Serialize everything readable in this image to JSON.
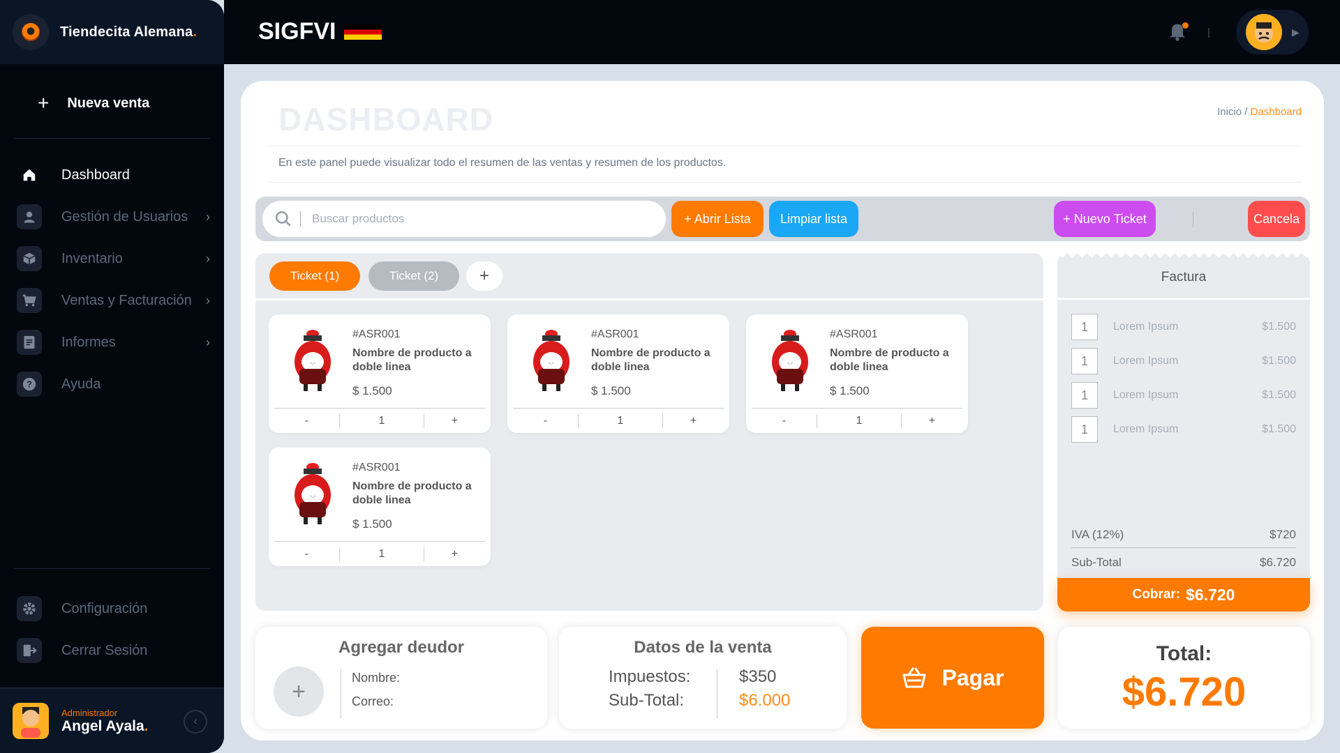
{
  "sidebar": {
    "brand": "Tiendecita Alemana",
    "brand_dot": ".",
    "new_sale": "Nueva venta",
    "items": [
      {
        "label": "Dashboard",
        "icon": "home-icon"
      },
      {
        "label": "Gestión de Usuarios",
        "icon": "user-icon"
      },
      {
        "label": "Inventario",
        "icon": "box-icon"
      },
      {
        "label": "Ventas y Facturación",
        "icon": "cart-icon"
      },
      {
        "label": "Informes",
        "icon": "report-icon"
      },
      {
        "label": "Ayuda",
        "icon": "help-icon"
      }
    ],
    "bottom_items": [
      {
        "label": "Configuración",
        "icon": "gear-icon"
      },
      {
        "label": "Cerrar Sesión",
        "icon": "logout-icon"
      }
    ],
    "profile": {
      "role": "Administrador",
      "name": "Angel Ayala",
      "name_dot": "."
    }
  },
  "topbar": {
    "title": "SIGFVI"
  },
  "main": {
    "title": "DASHBOARD",
    "breadcrumb": {
      "home": "Inicio",
      "sep": " / ",
      "current": "Dashboard"
    },
    "description": "En este panel puede visualizar todo el resumen de las ventas y resumen de los productos."
  },
  "toolbar": {
    "search_placeholder": "Buscar productos",
    "open_list": "+ Abrir Lista",
    "clear_list": "Limpiar lista",
    "new_ticket": "+ Nuevo Ticket",
    "cancel": "Cancela"
  },
  "tickets": {
    "tabs": [
      "Ticket (1)",
      "Ticket (2)"
    ],
    "add": "+",
    "products": [
      {
        "code": "#ASR001",
        "name": "Nombre de producto a doble linea",
        "price": "$ 1.500",
        "qty": "1"
      },
      {
        "code": "#ASR001",
        "name": "Nombre de producto a doble linea",
        "price": "$ 1.500",
        "qty": "1"
      },
      {
        "code": "#ASR001",
        "name": "Nombre de producto a doble linea",
        "price": "$ 1.500",
        "qty": "1"
      },
      {
        "code": "#ASR001",
        "name": "Nombre de producto a doble linea",
        "price": "$ 1.500",
        "qty": "1"
      }
    ],
    "minus": "-",
    "plus": "+"
  },
  "factura": {
    "title": "Factura",
    "rows": [
      {
        "qty": "1",
        "name": "Lorem Ipsum",
        "amount": "$1.500"
      },
      {
        "qty": "1",
        "name": "Lorem Ipsum",
        "amount": "$1.500"
      },
      {
        "qty": "1",
        "name": "Lorem Ipsum",
        "amount": "$1.500"
      },
      {
        "qty": "1",
        "name": "Lorem Ipsum",
        "amount": "$1.500"
      }
    ],
    "tax_label": "IVA (12%)",
    "tax_value": "$720",
    "subtotal_label": "Sub-Total",
    "subtotal_value": "$6.720",
    "charge_label": "Cobrar:",
    "charge_value": "$6.720"
  },
  "deudor": {
    "title": "Agregar deudor",
    "add": "+",
    "name_label": "Nombre:",
    "email_label": "Correo:"
  },
  "datos": {
    "title": "Datos de la venta",
    "tax_label": "Impuestos:",
    "tax_value": "$350",
    "subtotal_label": "Sub-Total:",
    "subtotal_value": "$6.000"
  },
  "pay": {
    "label": "Pagar"
  },
  "total": {
    "label": "Total:",
    "value": "$6.720"
  },
  "colors": {
    "accent": "#ff7a00",
    "sidebar": "#03080f",
    "blue": "#1aa7f5",
    "purple": "#cc4cf0",
    "red": "#ff4d4d"
  }
}
